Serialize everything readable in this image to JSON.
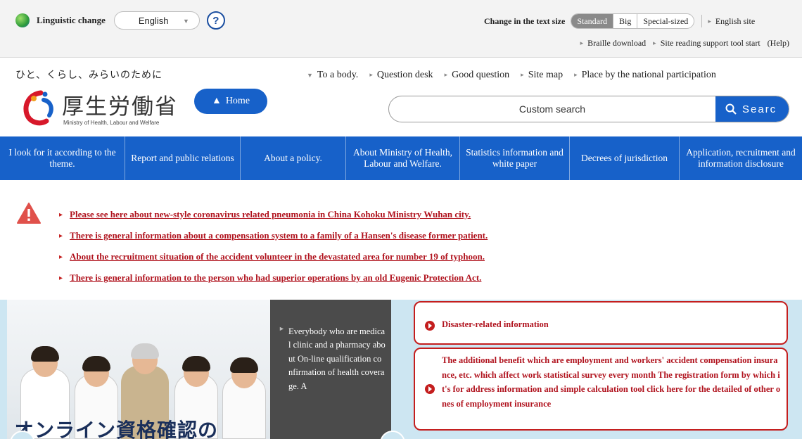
{
  "topbar": {
    "language_label": "Linguistic change",
    "language_selected": "English",
    "help_symbol": "?",
    "text_size_label": "Change in the text size",
    "text_sizes": [
      "Standard",
      "Big",
      "Special-sized"
    ],
    "english_site": "English site",
    "sublinks": [
      "Braille download",
      "Site reading support tool start",
      "(Help)"
    ]
  },
  "header": {
    "tagline": "ひと、くらし、みらいのために",
    "logo_text": "厚生労働省",
    "logo_sub": "Ministry of Health, Labour and Welfare",
    "home_label": "Home",
    "nav_links": [
      "To a body.",
      "Question desk",
      "Good question",
      "Site map",
      "Place by the national participation"
    ],
    "search_placeholder": "Custom search",
    "search_button": "Searc"
  },
  "global_nav": [
    "I look for it according to the theme.",
    "Report and public relations",
    "About a policy.",
    "About Ministry of Health, Labour and Welfare.",
    "Statistics information and white paper",
    "Decrees of jurisdiction",
    "Application, recruitment and information disclosure"
  ],
  "alerts": [
    "Please see here about new-style coronavirus related pneumonia in China Kohoku Ministry Wuhan city.",
    "There is general information about a compensation system to a family of a Hansen's disease former patient.",
    "About the recruitment situation of the accident volunteer in the devastated area for number 19 of typhoon.",
    "There is general information to the person who had superior operations by an old Eugenic Protection Act."
  ],
  "feature": {
    "photo_caption": "オンライン資格確認の",
    "panel_text": "Everybody who are medical clinic and a pharmacy about On-line qualification confirmation of health coverage. A",
    "cards": [
      "Disaster-related information",
      "The additional benefit which are employment and workers' accident compensation insurance, etc. which affect work statistical survey every month The registration form by which it's for address information and simple calculation tool click here for the detailed of other ones of employment insurance"
    ]
  },
  "colors": {
    "brand_blue": "#1761c9",
    "alert_red": "#b0121d",
    "feature_bg": "#cde6f2",
    "panel_dark": "#4b4b4b"
  }
}
